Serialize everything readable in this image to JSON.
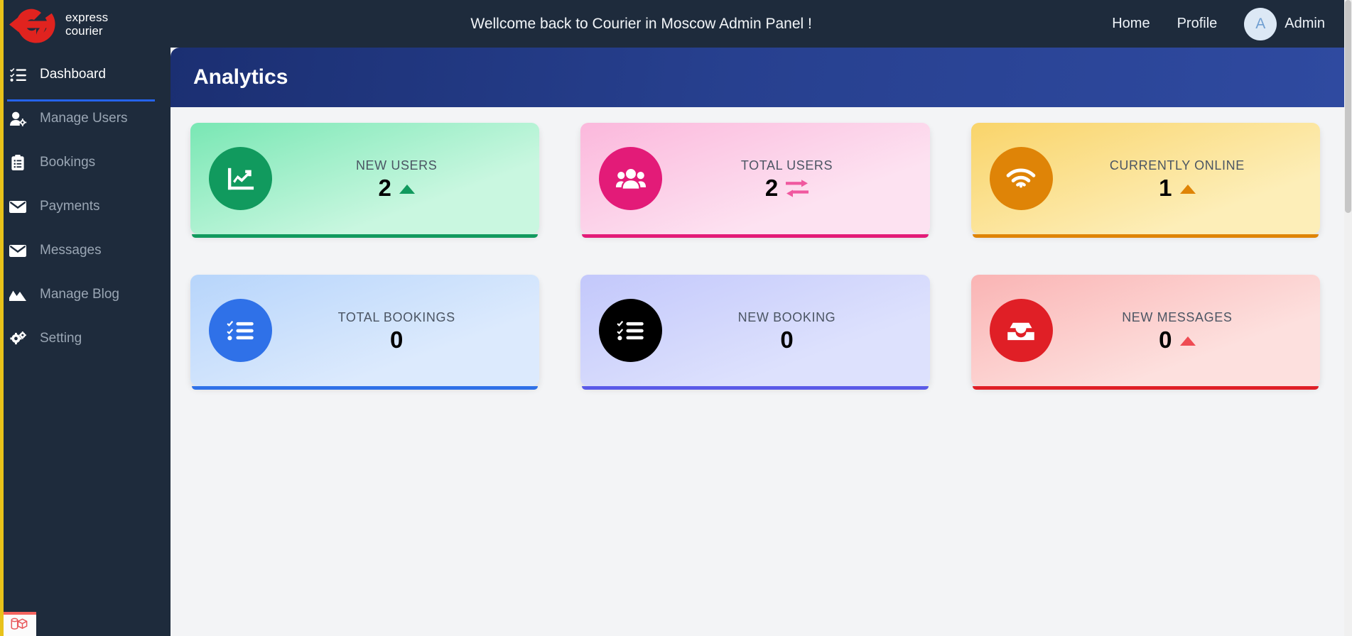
{
  "brand": {
    "logo_icon": "express-courier-arrow-e-logo",
    "line1": "express",
    "line2": "courier"
  },
  "header": {
    "welcome_text": "Wellcome back to Courier in Moscow Admin Panel !",
    "nav": [
      {
        "label": "Home",
        "name": "home"
      },
      {
        "label": "Profile",
        "name": "profile"
      }
    ],
    "user": {
      "initial": "A",
      "name": "Admin"
    }
  },
  "sidebar": {
    "items": [
      {
        "label": "Dashboard",
        "icon": "list-check-icon",
        "active": true
      },
      {
        "label": "Manage Users",
        "icon": "user-gear-icon",
        "active": false
      },
      {
        "label": "Bookings",
        "icon": "clipboard-list-icon",
        "active": false
      },
      {
        "label": "Payments",
        "icon": "envelope-icon",
        "active": false
      },
      {
        "label": "Messages",
        "icon": "envelope-icon",
        "active": false
      },
      {
        "label": "Manage Blog",
        "icon": "chart-area-icon",
        "active": false
      },
      {
        "label": "Setting",
        "icon": "gears-icon",
        "active": false
      }
    ]
  },
  "page": {
    "title": "Analytics"
  },
  "cards": [
    {
      "label": "NEW USERS",
      "value": "2",
      "icon": "chart-line-up-icon",
      "trend": "up-triangle",
      "accent": "#119a5e",
      "trend_color": "#119a5e",
      "bg_from": "#79e7b4",
      "bg_to": "#c9f7e0"
    },
    {
      "label": "TOTAL USERS",
      "value": "2",
      "icon": "users-group-icon",
      "trend": "exchange-arrows",
      "accent": "#e31b78",
      "trend_color": "#f0589f",
      "bg_from": "#fbb8dc",
      "bg_to": "#fde2f1"
    },
    {
      "label": "CURRENTLY ONLINE",
      "value": "1",
      "icon": "wifi-icon",
      "trend": "up-triangle",
      "accent": "#df8407",
      "trend_color": "#df8407",
      "bg_from": "#f9d46a",
      "bg_to": "#fdeeb8"
    },
    {
      "label": "TOTAL BOOKINGS",
      "value": "0",
      "icon": "tasks-checklist-icon",
      "trend": "none",
      "accent": "#2f71e8",
      "trend_color": "#2f71e8",
      "bg_from": "#b7d5fb",
      "bg_to": "#dceafd"
    },
    {
      "label": "NEW BOOKING",
      "value": "0",
      "icon": "tasks-checklist-icon",
      "trend": "none",
      "accent": "#000000",
      "trend_color": "#5a5ae8",
      "bg_from": "#c3c8fb",
      "bg_to": "#dde1fd",
      "underline_color": "#5a5ae8"
    },
    {
      "label": "NEW MESSAGES",
      "value": "0",
      "icon": "inbox-icon",
      "trend": "up-triangle",
      "accent": "#e01f26",
      "trend_color": "#ef4b53",
      "bg_from": "#fab4b4",
      "bg_to": "#fde0de"
    }
  ],
  "debugbar": {
    "icon": "debugbar-database-icon"
  }
}
